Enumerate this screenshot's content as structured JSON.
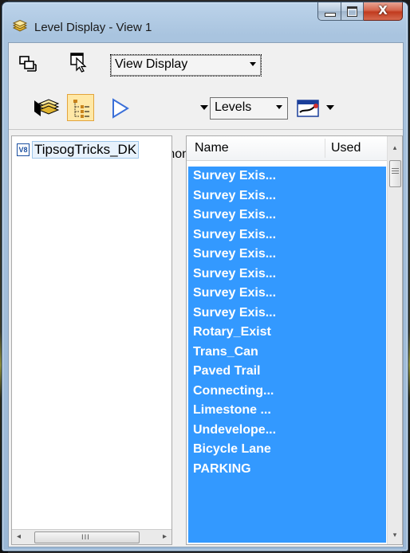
{
  "window": {
    "title": "Level Display - View 1",
    "close_glyph": "X"
  },
  "toolbar1": {
    "view_display_value": "View Display",
    "icons": [
      "views-icon",
      "select-view-icon"
    ]
  },
  "toolbar2": {
    "filter_value": "(none)",
    "mode_value": "Levels",
    "icons": [
      "level-manager-icon",
      "tree-list-icon",
      "filter-icon",
      "symbology-icon"
    ]
  },
  "tree": {
    "item_icon_text": "V8",
    "item_label": "TipsogTricks_DK"
  },
  "level_list": {
    "col_name": "Name",
    "col_used": "Used",
    "rows": [
      "Survey Exis...",
      "Survey Exis...",
      "Survey Exis...",
      "Survey Exis...",
      "Survey Exis...",
      "Survey Exis...",
      "Survey Exis...",
      "Survey Exis...",
      "Rotary_Exist",
      "Trans_Can",
      "Paved Trail",
      "Connecting...",
      "Limestone ...",
      "Undevelope...",
      "Bicycle Lane",
      "PARKING"
    ],
    "selection_color": "#3399ff"
  },
  "scrollbars": {
    "h_grip": "III",
    "left_arrow": "◂",
    "right_arrow": "▸",
    "up_arrow": "▴",
    "down_arrow": "▾"
  }
}
